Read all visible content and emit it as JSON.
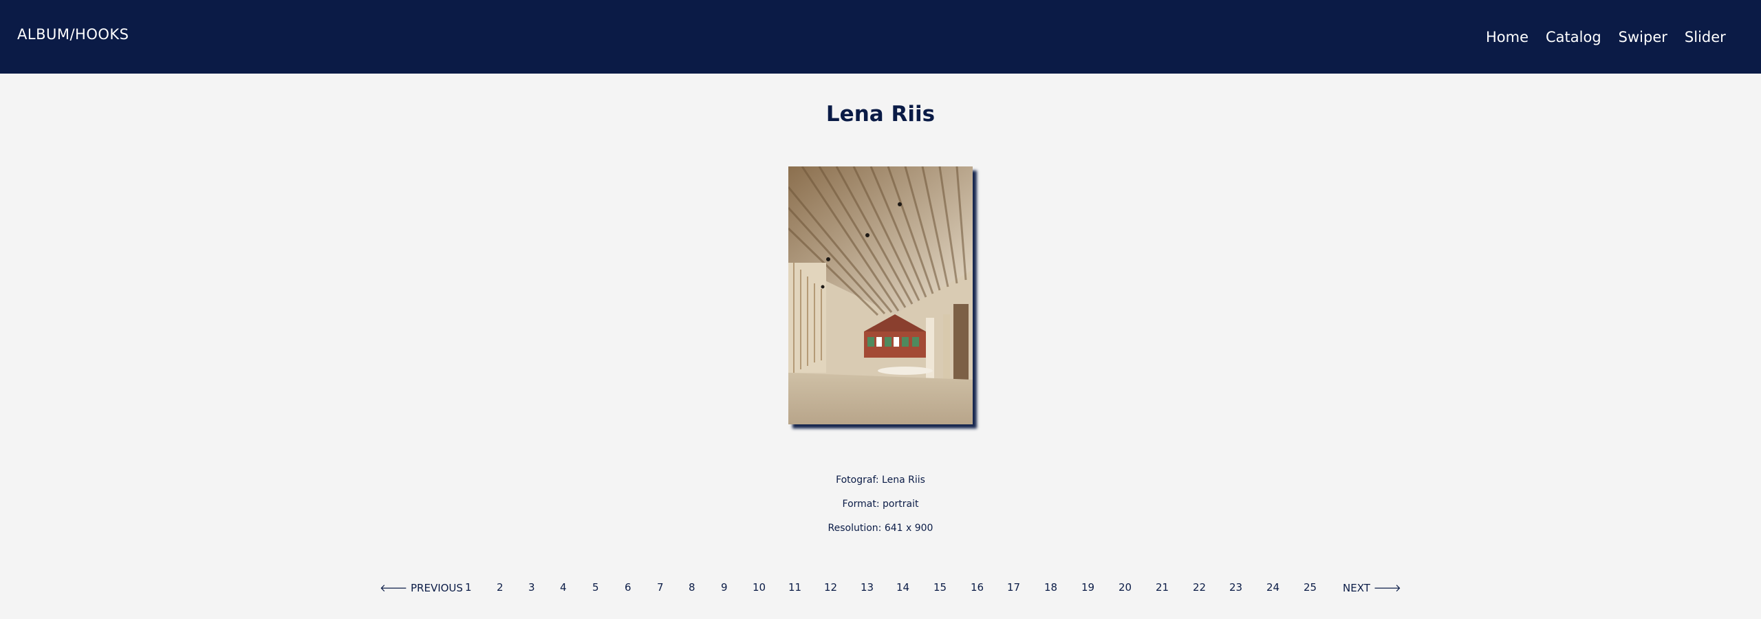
{
  "header": {
    "brand": "ALBUM/HOOKS",
    "nav": [
      "Home",
      "Catalog",
      "Swiper",
      "Slider"
    ]
  },
  "photo": {
    "title": "Lena Riis",
    "image_alt": "Interior of a building with slatted wooden roof and brick house in the background"
  },
  "meta": {
    "photographer": "Fotograf: Lena Riis",
    "format": "Format: portrait",
    "resolution": "Resolution: 641 x 900"
  },
  "pagination": {
    "previous": "🡐 PREVIOUS",
    "next": "NEXT 🡒",
    "pages": [
      "1",
      "2",
      "3",
      "4",
      "5",
      "6",
      "7",
      "8",
      "9",
      "10",
      "11",
      "12",
      "13",
      "14",
      "15",
      "16",
      "17",
      "18",
      "19",
      "20",
      "21",
      "22",
      "23",
      "24",
      "25"
    ],
    "current": "1"
  },
  "colors": {
    "navy": "#0b1b46",
    "background": "#f4f4f4"
  }
}
